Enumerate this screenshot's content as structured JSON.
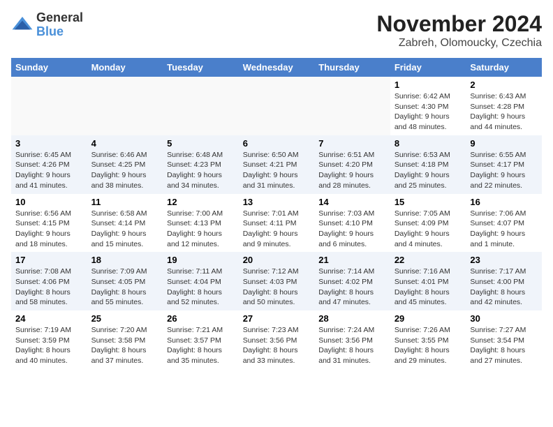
{
  "logo": {
    "line1": "General",
    "line2": "Blue"
  },
  "title": "November 2024",
  "subtitle": "Zabreh, Olomoucky, Czechia",
  "days_of_week": [
    "Sunday",
    "Monday",
    "Tuesday",
    "Wednesday",
    "Thursday",
    "Friday",
    "Saturday"
  ],
  "weeks": [
    [
      {
        "day": "",
        "info": ""
      },
      {
        "day": "",
        "info": ""
      },
      {
        "day": "",
        "info": ""
      },
      {
        "day": "",
        "info": ""
      },
      {
        "day": "",
        "info": ""
      },
      {
        "day": "1",
        "info": "Sunrise: 6:42 AM\nSunset: 4:30 PM\nDaylight: 9 hours and 48 minutes."
      },
      {
        "day": "2",
        "info": "Sunrise: 6:43 AM\nSunset: 4:28 PM\nDaylight: 9 hours and 44 minutes."
      }
    ],
    [
      {
        "day": "3",
        "info": "Sunrise: 6:45 AM\nSunset: 4:26 PM\nDaylight: 9 hours and 41 minutes."
      },
      {
        "day": "4",
        "info": "Sunrise: 6:46 AM\nSunset: 4:25 PM\nDaylight: 9 hours and 38 minutes."
      },
      {
        "day": "5",
        "info": "Sunrise: 6:48 AM\nSunset: 4:23 PM\nDaylight: 9 hours and 34 minutes."
      },
      {
        "day": "6",
        "info": "Sunrise: 6:50 AM\nSunset: 4:21 PM\nDaylight: 9 hours and 31 minutes."
      },
      {
        "day": "7",
        "info": "Sunrise: 6:51 AM\nSunset: 4:20 PM\nDaylight: 9 hours and 28 minutes."
      },
      {
        "day": "8",
        "info": "Sunrise: 6:53 AM\nSunset: 4:18 PM\nDaylight: 9 hours and 25 minutes."
      },
      {
        "day": "9",
        "info": "Sunrise: 6:55 AM\nSunset: 4:17 PM\nDaylight: 9 hours and 22 minutes."
      }
    ],
    [
      {
        "day": "10",
        "info": "Sunrise: 6:56 AM\nSunset: 4:15 PM\nDaylight: 9 hours and 18 minutes."
      },
      {
        "day": "11",
        "info": "Sunrise: 6:58 AM\nSunset: 4:14 PM\nDaylight: 9 hours and 15 minutes."
      },
      {
        "day": "12",
        "info": "Sunrise: 7:00 AM\nSunset: 4:13 PM\nDaylight: 9 hours and 12 minutes."
      },
      {
        "day": "13",
        "info": "Sunrise: 7:01 AM\nSunset: 4:11 PM\nDaylight: 9 hours and 9 minutes."
      },
      {
        "day": "14",
        "info": "Sunrise: 7:03 AM\nSunset: 4:10 PM\nDaylight: 9 hours and 6 minutes."
      },
      {
        "day": "15",
        "info": "Sunrise: 7:05 AM\nSunset: 4:09 PM\nDaylight: 9 hours and 4 minutes."
      },
      {
        "day": "16",
        "info": "Sunrise: 7:06 AM\nSunset: 4:07 PM\nDaylight: 9 hours and 1 minute."
      }
    ],
    [
      {
        "day": "17",
        "info": "Sunrise: 7:08 AM\nSunset: 4:06 PM\nDaylight: 8 hours and 58 minutes."
      },
      {
        "day": "18",
        "info": "Sunrise: 7:09 AM\nSunset: 4:05 PM\nDaylight: 8 hours and 55 minutes."
      },
      {
        "day": "19",
        "info": "Sunrise: 7:11 AM\nSunset: 4:04 PM\nDaylight: 8 hours and 52 minutes."
      },
      {
        "day": "20",
        "info": "Sunrise: 7:12 AM\nSunset: 4:03 PM\nDaylight: 8 hours and 50 minutes."
      },
      {
        "day": "21",
        "info": "Sunrise: 7:14 AM\nSunset: 4:02 PM\nDaylight: 8 hours and 47 minutes."
      },
      {
        "day": "22",
        "info": "Sunrise: 7:16 AM\nSunset: 4:01 PM\nDaylight: 8 hours and 45 minutes."
      },
      {
        "day": "23",
        "info": "Sunrise: 7:17 AM\nSunset: 4:00 PM\nDaylight: 8 hours and 42 minutes."
      }
    ],
    [
      {
        "day": "24",
        "info": "Sunrise: 7:19 AM\nSunset: 3:59 PM\nDaylight: 8 hours and 40 minutes."
      },
      {
        "day": "25",
        "info": "Sunrise: 7:20 AM\nSunset: 3:58 PM\nDaylight: 8 hours and 37 minutes."
      },
      {
        "day": "26",
        "info": "Sunrise: 7:21 AM\nSunset: 3:57 PM\nDaylight: 8 hours and 35 minutes."
      },
      {
        "day": "27",
        "info": "Sunrise: 7:23 AM\nSunset: 3:56 PM\nDaylight: 8 hours and 33 minutes."
      },
      {
        "day": "28",
        "info": "Sunrise: 7:24 AM\nSunset: 3:56 PM\nDaylight: 8 hours and 31 minutes."
      },
      {
        "day": "29",
        "info": "Sunrise: 7:26 AM\nSunset: 3:55 PM\nDaylight: 8 hours and 29 minutes."
      },
      {
        "day": "30",
        "info": "Sunrise: 7:27 AM\nSunset: 3:54 PM\nDaylight: 8 hours and 27 minutes."
      }
    ]
  ]
}
